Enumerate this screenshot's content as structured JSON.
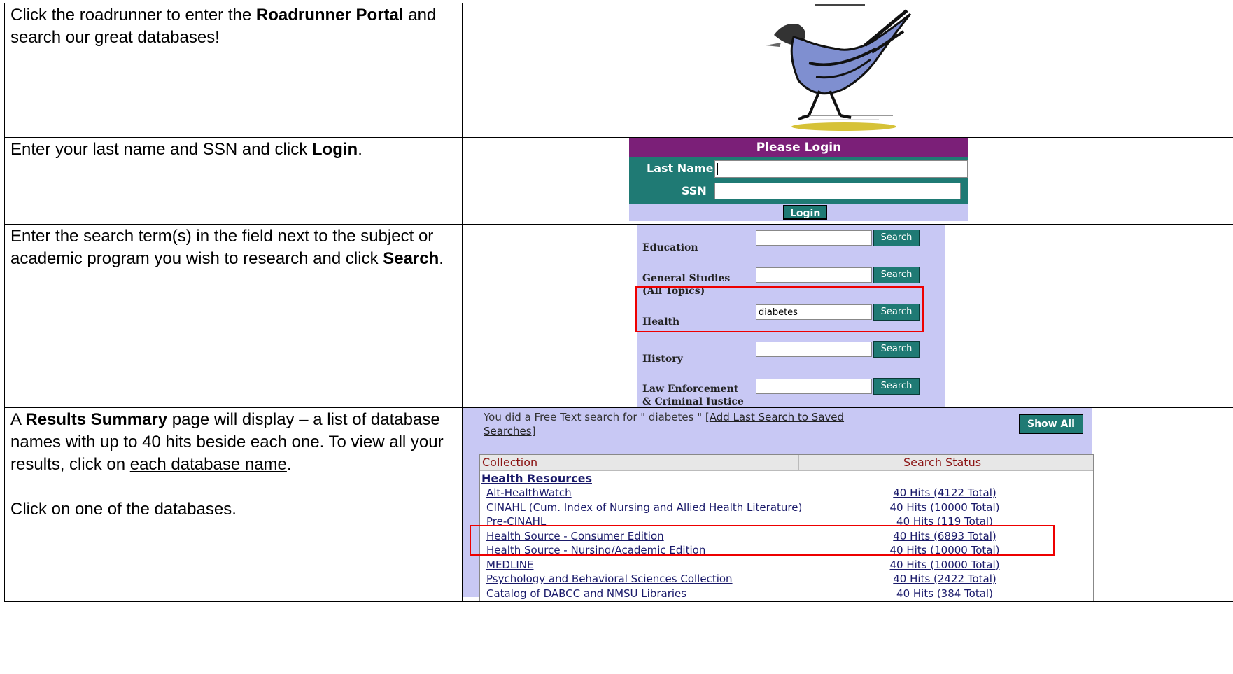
{
  "rows": [
    {
      "instructions": {
        "pre": "Click the roadrunner to enter the ",
        "bold": "Roadrunner Portal",
        "post": " and search our great databases!"
      }
    },
    {
      "instructions": {
        "pre": "Enter your last name and SSN and click ",
        "bold": "Login",
        "post": "."
      },
      "login": {
        "header": "Please Login",
        "last_name_label": "Last Name",
        "ssn_label": "SSN",
        "button": "Login",
        "header_color": "#7b1f78",
        "panel_color": "#1f7a74"
      }
    },
    {
      "instructions": {
        "pre": "Enter the search term(s) in the field next to the subject or academic program you wish to research and click ",
        "bold": "Search",
        "post": "."
      },
      "search": {
        "button_label": "Search",
        "subjects": [
          {
            "label": "Education",
            "value": ""
          },
          {
            "label": "General Studies (All Topics)",
            "value": ""
          },
          {
            "label": "Health",
            "value": "diabetes"
          },
          {
            "label": "History",
            "value": ""
          },
          {
            "label": "Law Enforcement & Criminal Justice",
            "value": ""
          }
        ],
        "highlight_color": "#e00000"
      }
    },
    {
      "instructions": {
        "pre": "A ",
        "bold": "Results Summary",
        "post": " page will display – a list of database names with up to 40 hits beside each one. To view all your results, click on ",
        "underlined": "each database name",
        "end": ".",
        "second": "Click on one of the databases."
      },
      "results": {
        "search_text": "You did a Free Text search for \" diabetes \"  [",
        "save_link": "Add Last Search to Saved Searches",
        "save_end": "]",
        "show_all": "Show All",
        "col_collection": "Collection",
        "col_status": "Search Status",
        "group": "Health Resources",
        "items": [
          {
            "name": "Alt-HealthWatch",
            "status": "40 Hits (4122 Total)"
          },
          {
            "name": "CINAHL (Cum. Index of Nursing and Allied Health Literature)",
            "status": "40 Hits (10000 Total)"
          },
          {
            "name": "Pre-CINAHL",
            "status": "40 Hits (119 Total)"
          },
          {
            "name": "Health Source - Consumer Edition",
            "status": "40 Hits (6893 Total)"
          },
          {
            "name": "Health Source - Nursing/Academic Edition",
            "status": "40 Hits (10000 Total)"
          },
          {
            "name": "MEDLINE",
            "status": "40 Hits (10000 Total)"
          },
          {
            "name": "Psychology and Behavioral Sciences Collection",
            "status": "40 Hits (2422 Total)"
          },
          {
            "name": "Catalog of DABCC and NMSU Libraries",
            "status": "40 Hits (384 Total)"
          }
        ]
      }
    }
  ]
}
